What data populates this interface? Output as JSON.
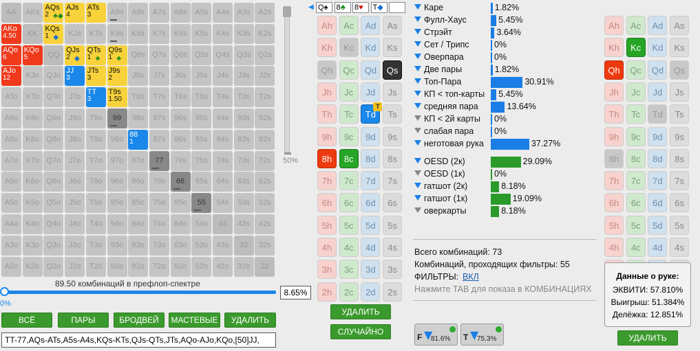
{
  "grid": {
    "ranks": [
      "A",
      "K",
      "Q",
      "J",
      "T",
      "9",
      "8",
      "7",
      "6",
      "5",
      "4",
      "3",
      "2"
    ],
    "special": {
      "AQs": {
        "style": "yellow",
        "sub": "2",
        "suit": "♣◆"
      },
      "AJs": {
        "style": "yellow",
        "sub": "4"
      },
      "ATs": {
        "style": "yellow",
        "sub": "3"
      },
      "A9s": {
        "style": "plain",
        "mark": true
      },
      "AKo": {
        "style": "red",
        "sub": "4.50"
      },
      "KQs": {
        "style": "yellow",
        "sub": "1",
        "suit": "◆"
      },
      "K9s": {
        "style": "plain",
        "mark": true
      },
      "AQo": {
        "style": "red",
        "sub": "6"
      },
      "KQo": {
        "style": "red",
        "sub": "5"
      },
      "QJs": {
        "style": "yellow",
        "sub": "2",
        "suit": "◆"
      },
      "QTs": {
        "style": "yellow",
        "sub": "1",
        "suit": "♣"
      },
      "Q9s": {
        "style": "yellow",
        "sub": "1",
        "suit": "♣"
      },
      "AJo": {
        "style": "red",
        "sub": "12"
      },
      "JJ": {
        "style": "blue",
        "sub": "3"
      },
      "JTs": {
        "style": "yellow",
        "sub": "3"
      },
      "J9s": {
        "style": "yellow",
        "sub": "2"
      },
      "TT": {
        "style": "blue",
        "sub": "3"
      },
      "T9s": {
        "style": "yellow",
        "sub": "1.50"
      },
      "99": {
        "style": "dark",
        "mark": true
      },
      "88": {
        "style": "blue",
        "sub": "1"
      },
      "77": {
        "style": "dark",
        "mark": true
      },
      "66": {
        "style": "dark",
        "mark": true
      },
      "55": {
        "style": "dark",
        "mark": true
      }
    },
    "slider_label": "50%",
    "combos_text": "89.50 комбинаций в префлоп-спектре",
    "percent_value": "8.65%",
    "percent_left": "0%",
    "range_text": "TT-77,AQs-ATs,A5s-A4s,KQs-KTs,QJs-QTs,JTs,AQo-AJo,KQo,[50]JJ,"
  },
  "buttons": {
    "all": "ВСЁ",
    "pairs": "ПАРЫ",
    "broadway": "БРОДВЕЙ",
    "suited": "МАСТЕВЫЕ",
    "delete": "УДАЛИТЬ",
    "board_delete": "УДАЛИТЬ",
    "random": "СЛУЧАЙНО",
    "hand_delete": "УДАЛИТЬ"
  },
  "board": {
    "slots": [
      "Q",
      "8",
      "8",
      "T",
      ""
    ],
    "slot_suits": [
      "♠",
      "♣",
      "♥",
      "◆",
      ""
    ]
  },
  "board_cards": {
    "rows": [
      [
        "Ah",
        "Ac",
        "Ad",
        "As"
      ],
      [
        "Kh",
        "Kc",
        "Kd",
        "Ks"
      ],
      [
        "Qh",
        "Qc",
        "Qd",
        "Qs"
      ],
      [
        "Jh",
        "Jc",
        "Jd",
        "Js"
      ],
      [
        "Th",
        "Tc",
        "Td",
        "Ts"
      ],
      [
        "9h",
        "9c",
        "9d",
        "9s"
      ],
      [
        "8h",
        "8c",
        "8d",
        "8s"
      ],
      [
        "7h",
        "7c",
        "7d",
        "7s"
      ],
      [
        "6h",
        "6c",
        "6d",
        "6s"
      ],
      [
        "5h",
        "5c",
        "5d",
        "5s"
      ],
      [
        "4h",
        "4c",
        "4d",
        "4s"
      ],
      [
        "3h",
        "3c",
        "3d",
        "3s"
      ],
      [
        "2h",
        "2c",
        "2d",
        "2s"
      ]
    ],
    "state": {
      "Kc": "hs",
      "Qh": "hs",
      "Qs": "sel-s",
      "Td": "sel-d",
      "8h": "sel-h",
      "8c": "sel-c"
    },
    "td_badge": "T"
  },
  "hand_cards": {
    "state": {
      "Kc": "sel-c",
      "Qh": "sel-h",
      "Qs": "hs",
      "8h": "hs",
      "Td": "hs"
    }
  },
  "stats": {
    "items": [
      {
        "name": "Каре",
        "pct": "1.82%",
        "val": 1.82,
        "color": "#1a7ee6"
      },
      {
        "name": "Фулл-Хаус",
        "pct": "5.45%",
        "val": 5.45,
        "color": "#1a7ee6"
      },
      {
        "name": "Стрэйт",
        "pct": "3.64%",
        "val": 3.64,
        "color": "#1a7ee6"
      },
      {
        "name": "Сет / Трипс",
        "pct": "0%",
        "val": 0,
        "color": "#1a7ee6"
      },
      {
        "name": "Оверпара",
        "pct": "0%",
        "val": 0,
        "color": "#1a7ee6"
      },
      {
        "name": "Две пары",
        "pct": "1.82%",
        "val": 1.82,
        "color": "#1a7ee6"
      },
      {
        "name": "Топ-Пара",
        "pct": "30.91%",
        "val": 30.91,
        "color": "#1a7ee6"
      },
      {
        "name": "КП < топ-карты",
        "pct": "5.45%",
        "val": 5.45,
        "color": "#1a7ee6"
      },
      {
        "name": "средняя пара",
        "pct": "13.64%",
        "val": 13.64,
        "color": "#1a7ee6"
      },
      {
        "name": "КП < 2й карты",
        "pct": "0%",
        "val": 0,
        "color": "#1a7ee6"
      },
      {
        "name": "слабая пара",
        "pct": "0%",
        "val": 0,
        "color": "#1a7ee6"
      },
      {
        "name": "неготовая рука",
        "pct": "37.27%",
        "val": 37.27,
        "color": "#1a7ee6"
      }
    ],
    "draws": [
      {
        "name": "OESD (2к)",
        "pct": "29.09%",
        "val": 29.09,
        "color": "#2a9a2a"
      },
      {
        "name": "OESD (1к)",
        "pct": "0%",
        "val": 0,
        "color": "#2a9a2a"
      },
      {
        "name": "гатшот (2к)",
        "pct": "8.18%",
        "val": 8.18,
        "color": "#2a9a2a"
      },
      {
        "name": "гатшот (1к)",
        "pct": "19.09%",
        "val": 19.09,
        "color": "#2a9a2a"
      },
      {
        "name": "оверкарты",
        "pct": "8.18%",
        "val": 8.18,
        "color": "#2a9a2a"
      }
    ],
    "total": "Всего комбинаций: 73",
    "passing": "Комбинаций, проходящих фильтры: 55",
    "filters_label": "ФИЛЬТРЫ:",
    "filters_value": "ВКЛ",
    "tab_hint": "Нажмите TAB для показа в КОМБИНАЦИЯХ",
    "f_label": "F",
    "f_pct": "81.6%",
    "t_label": "T",
    "t_pct": "75.3%"
  },
  "hand_data": {
    "title": "Данные о руке:",
    "equity": "ЭКВИТИ: 57.810%",
    "win": "Выигрыш: 51.384%",
    "tie": "Делёжка: 12.851%"
  }
}
